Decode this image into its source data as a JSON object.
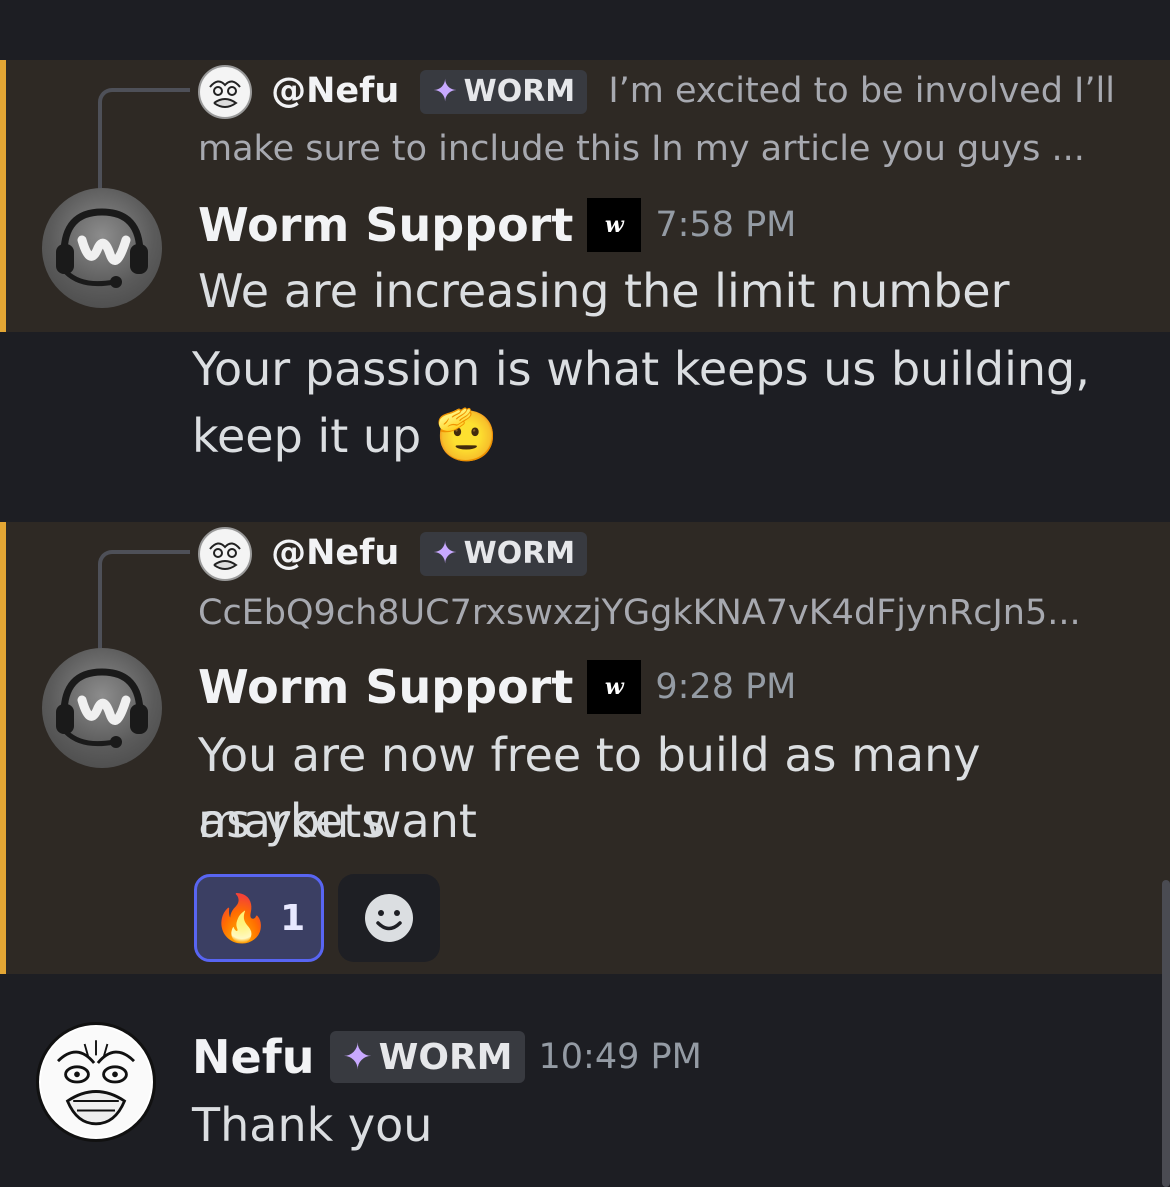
{
  "messages": [
    {
      "reply": {
        "mention": "@Nefu",
        "tag": "WORM",
        "preview_first": "I’m excited to be involved I’ll",
        "preview_second": "make sure to include this In my article you guys ..."
      },
      "author": "Worm Support",
      "bot_badge": "w",
      "time": "7:58 PM",
      "lines": [
        "We are increasing the limit number"
      ]
    },
    {
      "lines": [
        "Your passion is what keeps us building,",
        "keep it up"
      ],
      "emoji": "🫡"
    },
    {
      "reply": {
        "mention": "@Nefu",
        "tag": "WORM",
        "preview_second": "CcEbQ9ch8UC7rxswxzjYGgkKNA7vK4dFjynRcJn5..."
      },
      "author": "Worm Support",
      "bot_badge": "w",
      "time": "9:28 PM",
      "lines": [
        "You are now free to build as many markets",
        "as you want"
      ],
      "reactions": [
        {
          "emoji": "🔥",
          "count": "1"
        }
      ]
    },
    {
      "author": "Nefu",
      "tag": "WORM",
      "time": "10:49 PM",
      "lines": [
        "Thank you"
      ]
    }
  ],
  "colors": {
    "background": "#1d1e23",
    "mention_highlight": "#2e2924",
    "mention_bar": "#e3a634",
    "reaction_active_border": "#5865f2",
    "role_diamond": "#c8a9ff"
  },
  "icons": {
    "add_reaction": "smiley-face-icon",
    "role_icon": "diamond-sparkle-icon"
  }
}
